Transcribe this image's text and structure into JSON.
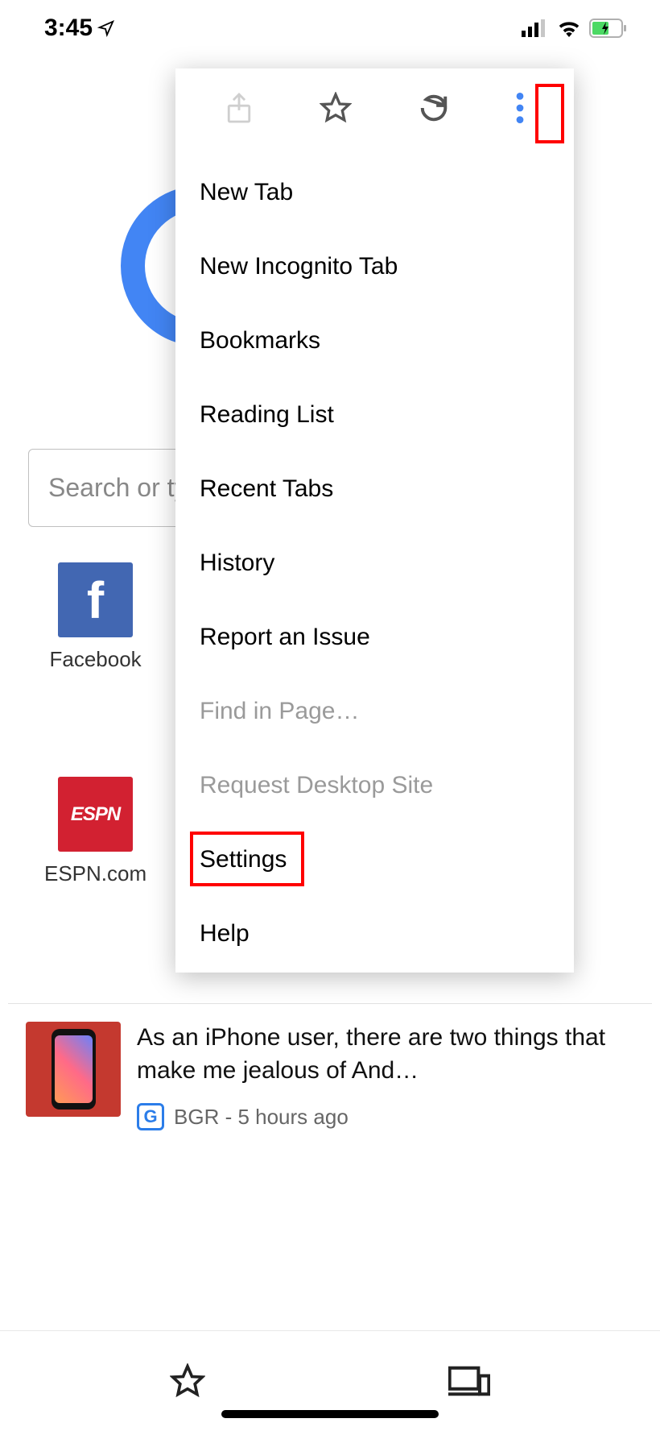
{
  "status": {
    "time": "3:45"
  },
  "search": {
    "placeholder": "Search or ty"
  },
  "bookmarks": [
    {
      "label": "Facebook"
    },
    {
      "label": "ESPN.com"
    }
  ],
  "article": {
    "title": "As an iPhone user, there are two things that make me jealous of And…",
    "source": "BGR",
    "separator": " - ",
    "age": "5 hours ago"
  },
  "menu": {
    "items": [
      {
        "label": "New Tab",
        "disabled": false
      },
      {
        "label": "New Incognito Tab",
        "disabled": false
      },
      {
        "label": "Bookmarks",
        "disabled": false
      },
      {
        "label": "Reading List",
        "disabled": false
      },
      {
        "label": "Recent Tabs",
        "disabled": false
      },
      {
        "label": "History",
        "disabled": false
      },
      {
        "label": "Report an Issue",
        "disabled": false
      },
      {
        "label": "Find in Page…",
        "disabled": true
      },
      {
        "label": "Request Desktop Site",
        "disabled": true
      },
      {
        "label": "Settings",
        "disabled": false
      },
      {
        "label": "Help",
        "disabled": false
      }
    ]
  },
  "espn_text": "ESPN"
}
